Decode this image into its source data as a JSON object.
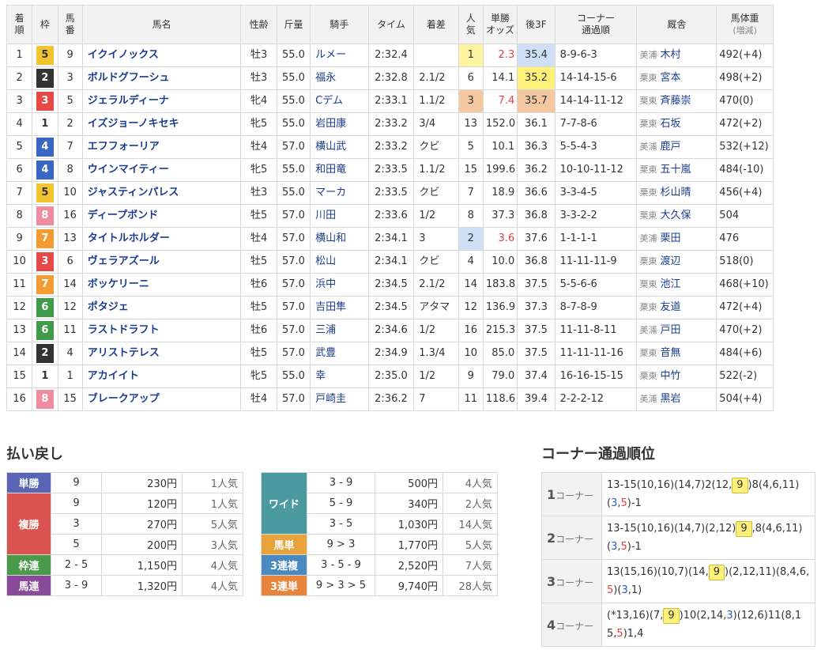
{
  "headers": {
    "rank": [
      "着",
      "順"
    ],
    "frame": [
      "枠",
      ""
    ],
    "num": [
      "馬",
      "番"
    ],
    "horse": [
      "馬名",
      ""
    ],
    "sexage": [
      "性齢",
      ""
    ],
    "weight": [
      "斤量",
      ""
    ],
    "jockey": [
      "騎手",
      ""
    ],
    "time": [
      "タイム",
      ""
    ],
    "margin": [
      "着差",
      ""
    ],
    "pop": [
      "人",
      "気"
    ],
    "odds": [
      "単勝",
      "オッズ"
    ],
    "f3": [
      "後3F",
      ""
    ],
    "corner": [
      "コーナー",
      "通過順"
    ],
    "trainer": [
      "厩舎",
      ""
    ],
    "bw": [
      "馬体重",
      "(増減)"
    ]
  },
  "frame_colors": {
    "1": {
      "bg": "#ffffff",
      "fg": "#333333"
    },
    "2": {
      "bg": "#333333",
      "fg": "#ffffff"
    },
    "3": {
      "bg": "#e74848",
      "fg": "#ffffff"
    },
    "4": {
      "bg": "#3a66c4",
      "fg": "#ffffff"
    },
    "5": {
      "bg": "#f2c42e",
      "fg": "#333333"
    },
    "6": {
      "bg": "#3f9a4a",
      "fg": "#ffffff"
    },
    "7": {
      "bg": "#f39c33",
      "fg": "#ffffff"
    },
    "8": {
      "bg": "#f08ca0",
      "fg": "#ffffff"
    }
  },
  "results": [
    {
      "rank": "1",
      "frame": "5",
      "num": "9",
      "horse": "イクイノックス",
      "sexage": "牡3",
      "weight": "55.0",
      "jockey": "ルメー",
      "time": "2:32.4",
      "margin": "",
      "pop": "1",
      "odds": "2.3",
      "f3": "35.4",
      "corner": "8-9-6-3",
      "area": "美浦",
      "trainer": "木村",
      "bw": "492(+4)",
      "pop_hl": "yellow",
      "odds_hot": true,
      "f3_hl": "blue"
    },
    {
      "rank": "2",
      "frame": "2",
      "num": "3",
      "horse": "ボルドグフーシュ",
      "sexage": "牡3",
      "weight": "55.0",
      "jockey": "福永",
      "time": "2:32.8",
      "margin": "2.1/2",
      "pop": "6",
      "odds": "14.1",
      "f3": "35.2",
      "corner": "14-14-15-6",
      "area": "栗東",
      "trainer": "宮本",
      "bw": "498(+2)",
      "pop_hl": "",
      "odds_hot": false,
      "f3_hl": "yellow"
    },
    {
      "rank": "3",
      "frame": "3",
      "num": "5",
      "horse": "ジェラルディーナ",
      "sexage": "牝4",
      "weight": "55.0",
      "jockey": "Cデム",
      "time": "2:33.1",
      "margin": "1.1/2",
      "pop": "3",
      "odds": "7.4",
      "f3": "35.7",
      "corner": "14-14-11-12",
      "area": "栗東",
      "trainer": "斉藤崇",
      "bw": "470(0)",
      "pop_hl": "orange",
      "odds_hot": true,
      "f3_hl": "orange"
    },
    {
      "rank": "4",
      "frame": "1",
      "num": "2",
      "horse": "イズジョーノキセキ",
      "sexage": "牝5",
      "weight": "55.0",
      "jockey": "岩田康",
      "time": "2:33.2",
      "margin": "3/4",
      "pop": "13",
      "odds": "152.0",
      "f3": "36.1",
      "corner": "7-7-8-6",
      "area": "栗東",
      "trainer": "石坂",
      "bw": "472(+2)",
      "pop_hl": "",
      "odds_hot": false,
      "f3_hl": ""
    },
    {
      "rank": "5",
      "frame": "4",
      "num": "7",
      "horse": "エフフォーリア",
      "sexage": "牡4",
      "weight": "57.0",
      "jockey": "横山武",
      "time": "2:33.2",
      "margin": "クビ",
      "pop": "5",
      "odds": "10.1",
      "f3": "36.3",
      "corner": "5-5-4-3",
      "area": "美浦",
      "trainer": "鹿戸",
      "bw": "532(+12)",
      "pop_hl": "",
      "odds_hot": false,
      "f3_hl": ""
    },
    {
      "rank": "6",
      "frame": "4",
      "num": "8",
      "horse": "ウインマイティー",
      "sexage": "牝5",
      "weight": "55.0",
      "jockey": "和田竜",
      "time": "2:33.5",
      "margin": "1.1/2",
      "pop": "15",
      "odds": "199.6",
      "f3": "36.2",
      "corner": "10-10-11-12",
      "area": "栗東",
      "trainer": "五十嵐",
      "bw": "484(-10)",
      "pop_hl": "",
      "odds_hot": false,
      "f3_hl": ""
    },
    {
      "rank": "7",
      "frame": "5",
      "num": "10",
      "horse": "ジャスティンパレス",
      "sexage": "牡3",
      "weight": "55.0",
      "jockey": "マーカ",
      "time": "2:33.5",
      "margin": "クビ",
      "pop": "7",
      "odds": "18.9",
      "f3": "36.6",
      "corner": "3-3-4-5",
      "area": "栗東",
      "trainer": "杉山晴",
      "bw": "456(+4)",
      "pop_hl": "",
      "odds_hot": false,
      "f3_hl": ""
    },
    {
      "rank": "8",
      "frame": "8",
      "num": "16",
      "horse": "ディープボンド",
      "sexage": "牡5",
      "weight": "57.0",
      "jockey": "川田",
      "time": "2:33.6",
      "margin": "1/2",
      "pop": "8",
      "odds": "37.3",
      "f3": "36.8",
      "corner": "3-3-2-2",
      "area": "栗東",
      "trainer": "大久保",
      "bw": "504",
      "pop_hl": "",
      "odds_hot": false,
      "f3_hl": ""
    },
    {
      "rank": "9",
      "frame": "7",
      "num": "13",
      "horse": "タイトルホルダー",
      "sexage": "牡4",
      "weight": "57.0",
      "jockey": "横山和",
      "time": "2:34.1",
      "margin": "3",
      "pop": "2",
      "odds": "3.6",
      "f3": "37.6",
      "corner": "1-1-1-1",
      "area": "美浦",
      "trainer": "栗田",
      "bw": "476",
      "pop_hl": "blue",
      "odds_hot": true,
      "f3_hl": ""
    },
    {
      "rank": "10",
      "frame": "3",
      "num": "6",
      "horse": "ヴェラアズール",
      "sexage": "牡5",
      "weight": "57.0",
      "jockey": "松山",
      "time": "2:34.1",
      "margin": "クビ",
      "pop": "4",
      "odds": "10.0",
      "f3": "36.8",
      "corner": "11-11-11-9",
      "area": "栗東",
      "trainer": "渡辺",
      "bw": "518(0)",
      "pop_hl": "",
      "odds_hot": false,
      "f3_hl": ""
    },
    {
      "rank": "11",
      "frame": "7",
      "num": "14",
      "horse": "ボッケリーニ",
      "sexage": "牡6",
      "weight": "57.0",
      "jockey": "浜中",
      "time": "2:34.5",
      "margin": "2.1/2",
      "pop": "14",
      "odds": "183.8",
      "f3": "37.5",
      "corner": "5-5-6-6",
      "area": "栗東",
      "trainer": "池江",
      "bw": "468(+10)",
      "pop_hl": "",
      "odds_hot": false,
      "f3_hl": ""
    },
    {
      "rank": "12",
      "frame": "6",
      "num": "12",
      "horse": "ポタジェ",
      "sexage": "牡5",
      "weight": "57.0",
      "jockey": "吉田隼",
      "time": "2:34.5",
      "margin": "アタマ",
      "pop": "12",
      "odds": "136.9",
      "f3": "37.3",
      "corner": "8-7-8-9",
      "area": "栗東",
      "trainer": "友道",
      "bw": "472(+4)",
      "pop_hl": "",
      "odds_hot": false,
      "f3_hl": ""
    },
    {
      "rank": "13",
      "frame": "6",
      "num": "11",
      "horse": "ラストドラフト",
      "sexage": "牡6",
      "weight": "57.0",
      "jockey": "三浦",
      "time": "2:34.6",
      "margin": "1/2",
      "pop": "16",
      "odds": "215.3",
      "f3": "37.5",
      "corner": "11-11-8-11",
      "area": "美浦",
      "trainer": "戸田",
      "bw": "470(+2)",
      "pop_hl": "",
      "odds_hot": false,
      "f3_hl": ""
    },
    {
      "rank": "14",
      "frame": "2",
      "num": "4",
      "horse": "アリストテレス",
      "sexage": "牡5",
      "weight": "57.0",
      "jockey": "武豊",
      "time": "2:34.9",
      "margin": "1.3/4",
      "pop": "10",
      "odds": "85.0",
      "f3": "37.5",
      "corner": "11-11-11-16",
      "area": "栗東",
      "trainer": "音無",
      "bw": "484(+6)",
      "pop_hl": "",
      "odds_hot": false,
      "f3_hl": ""
    },
    {
      "rank": "15",
      "frame": "1",
      "num": "1",
      "horse": "アカイイト",
      "sexage": "牝5",
      "weight": "55.0",
      "jockey": "幸",
      "time": "2:35.0",
      "margin": "1/2",
      "pop": "9",
      "odds": "79.0",
      "f3": "37.4",
      "corner": "16-16-15-15",
      "area": "栗東",
      "trainer": "中竹",
      "bw": "522(-2)",
      "pop_hl": "",
      "odds_hot": false,
      "f3_hl": ""
    },
    {
      "rank": "16",
      "frame": "8",
      "num": "15",
      "horse": "ブレークアップ",
      "sexage": "牡4",
      "weight": "57.0",
      "jockey": "戸崎圭",
      "time": "2:36.2",
      "margin": "7",
      "pop": "11",
      "odds": "118.6",
      "f3": "39.4",
      "corner": "2-2-2-12",
      "area": "美浦",
      "trainer": "黒岩",
      "bw": "504(+4)",
      "pop_hl": "",
      "odds_hot": false,
      "f3_hl": ""
    }
  ],
  "payout": {
    "title": "払い戻し",
    "left": [
      {
        "label": "単勝",
        "color": "#5a64b4",
        "rows": [
          {
            "combo": "9",
            "amount": "230円",
            "pop": "1人気"
          }
        ]
      },
      {
        "label": "複勝",
        "color": "#d9534f",
        "rows": [
          {
            "combo": "9",
            "amount": "120円",
            "pop": "1人気"
          },
          {
            "combo": "3",
            "amount": "270円",
            "pop": "5人気"
          },
          {
            "combo": "5",
            "amount": "200円",
            "pop": "3人気"
          }
        ]
      },
      {
        "label": "枠連",
        "color": "#4a9a4a",
        "rows": [
          {
            "combo": "2 - 5",
            "amount": "1,150円",
            "pop": "4人気"
          }
        ]
      },
      {
        "label": "馬連",
        "color": "#8a4a9a",
        "rows": [
          {
            "combo": "3 - 9",
            "amount": "1,320円",
            "pop": "4人気"
          }
        ]
      }
    ],
    "right": [
      {
        "label": "ワイド",
        "color": "#4a9aa0",
        "rows": [
          {
            "combo": "3 - 9",
            "amount": "500円",
            "pop": "4人気"
          },
          {
            "combo": "5 - 9",
            "amount": "340円",
            "pop": "2人気"
          },
          {
            "combo": "3 - 5",
            "amount": "1,030円",
            "pop": "14人気"
          }
        ]
      },
      {
        "label": "馬単",
        "color": "#e8a33c",
        "rows": [
          {
            "combo": "9 > 3",
            "amount": "1,770円",
            "pop": "5人気"
          }
        ]
      },
      {
        "label": "3連複",
        "color": "#4a8ac0",
        "rows": [
          {
            "combo": "3 - 5 - 9",
            "amount": "2,520円",
            "pop": "7人気"
          }
        ]
      },
      {
        "label": "3連単",
        "color": "#e8843c",
        "rows": [
          {
            "combo": "9 > 3 > 5",
            "amount": "9,740円",
            "pop": "28人気"
          }
        ]
      }
    ]
  },
  "corners": {
    "title": "コーナー通過順位",
    "suffix": "コーナー",
    "rows": [
      {
        "num": "1",
        "segments": [
          {
            "t": "13-15(10,16)(14,7)2(12,",
            "s": ""
          },
          {
            "t": "9",
            "s": "hl"
          },
          {
            "t": ")8(4,6,11)(",
            "s": ""
          },
          {
            "t": "3",
            "s": "blue"
          },
          {
            "t": ",",
            "s": ""
          },
          {
            "t": "5",
            "s": "red"
          },
          {
            "t": ")-1",
            "s": ""
          }
        ]
      },
      {
        "num": "2",
        "segments": [
          {
            "t": "13-15(10,16)(14,7)(2,12)",
            "s": ""
          },
          {
            "t": "9",
            "s": "hl"
          },
          {
            "t": ",8(4,6,11)(",
            "s": ""
          },
          {
            "t": "3",
            "s": "blue"
          },
          {
            "t": ",",
            "s": ""
          },
          {
            "t": "5",
            "s": "red"
          },
          {
            "t": ")-1",
            "s": ""
          }
        ]
      },
      {
        "num": "3",
        "segments": [
          {
            "t": "13(15,16)(10,7)(14,",
            "s": ""
          },
          {
            "t": "9",
            "s": "hl"
          },
          {
            "t": ")(2,12,11)(8,4,6,",
            "s": ""
          },
          {
            "t": "5",
            "s": "red"
          },
          {
            "t": ")(",
            "s": ""
          },
          {
            "t": "3",
            "s": "blue"
          },
          {
            "t": ",1)",
            "s": ""
          }
        ]
      },
      {
        "num": "4",
        "segments": [
          {
            "t": "(*13,16)(7,",
            "s": ""
          },
          {
            "t": "9",
            "s": "hl"
          },
          {
            "t": ")10(2,14,",
            "s": ""
          },
          {
            "t": "3",
            "s": "blue"
          },
          {
            "t": ")(12,6)11(8,15,",
            "s": ""
          },
          {
            "t": "5",
            "s": "red"
          },
          {
            "t": ")1,4",
            "s": ""
          }
        ]
      }
    ]
  }
}
